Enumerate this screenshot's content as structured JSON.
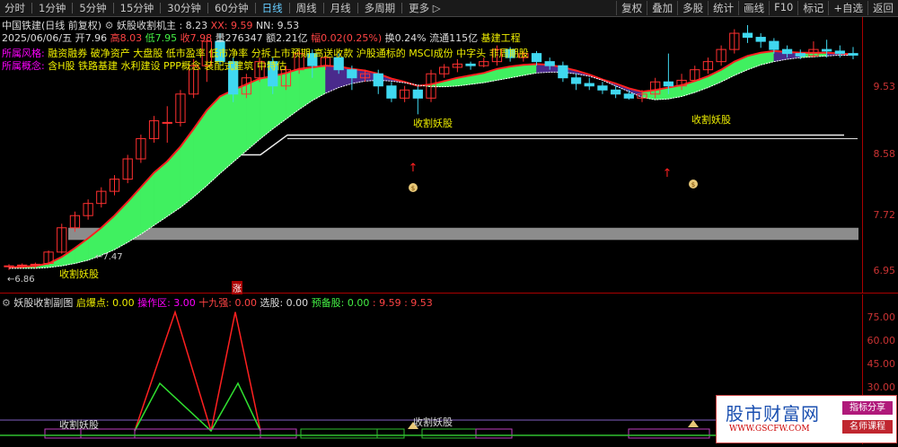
{
  "toolbar": {
    "items": [
      "分时",
      "1分钟",
      "5分钟",
      "15分钟",
      "30分钟",
      "60分钟",
      "日线",
      "周线",
      "月线",
      "多周期",
      "更多 ▷"
    ],
    "active_index": 6,
    "right_items": [
      "复权",
      "叠加",
      "多股",
      "统计",
      "画线",
      "F10",
      "标记",
      "+自选",
      "返回"
    ]
  },
  "header": {
    "stock": "中国铁建(日线 前复权)",
    "indicator": "妖股收割机主",
    "v1_label": ": 8.23",
    "xx_label": "XX: 9.59",
    "nn_label": "NN: 9.53",
    "bar_date": "2025/06/06/五",
    "open": "开7.96",
    "high": "高8.03",
    "low": "低7.95",
    "close": "收7.98",
    "volume": "量276347",
    "amount": "额2.21亿",
    "change": "幅0.02(0.25%)",
    "turnover": "换0.24%",
    "float": "流通115亿",
    "sector": "基建工程"
  },
  "style_line": {
    "label": "所属风格:",
    "text": "融资融券 破净资产 大盘股 低市盈率 低市净率 分拆上市预期 高送收款 沪股通标的 MSCI成份 中字头 非周期股"
  },
  "concept_line": {
    "label": "所属概念:",
    "text": "含H股 铁路基建 水利建设 PPP概念 装配式建筑 中特估"
  },
  "main_labels": {
    "harvest": "收割妖股",
    "low_price": "6.86",
    "mid_price": "7.47",
    "zhang": "涨"
  },
  "sub_header": {
    "name": "妖股收割副图",
    "f1": "启爆点: 0.00",
    "f2": "操作区: 3.00",
    "f3": "十九强: 0.00",
    "f4": "选股: 0.00",
    "f5": "预备股: 0.00",
    "f6": ": 9.59",
    "f7": ": 9.53"
  },
  "main_axis": [
    "9.53",
    "8.58",
    "7.72",
    "6.95"
  ],
  "sub_axis": [
    "75.00",
    "60.00",
    "45.00",
    "30.00"
  ],
  "watermark": {
    "title": "股市财富网",
    "url": "WWW.GSCFW.COM",
    "tag1": "指标分享",
    "tag2": "名师课程"
  },
  "chart_data": [
    {
      "type": "candlestick",
      "ylim": [
        6.6,
        10.0
      ],
      "candles": [
        [
          6.92,
          6.93,
          6.88,
          6.95
        ],
        [
          6.93,
          6.94,
          6.9,
          6.96
        ],
        [
          6.94,
          6.95,
          6.9,
          6.97
        ],
        [
          6.96,
          7.1,
          6.94,
          7.12
        ],
        [
          7.1,
          7.4,
          7.08,
          7.45
        ],
        [
          7.4,
          7.55,
          7.35,
          7.6
        ],
        [
          7.55,
          7.7,
          7.5,
          7.75
        ],
        [
          7.7,
          7.85,
          7.65,
          7.9
        ],
        [
          7.85,
          8.0,
          7.8,
          8.05
        ],
        [
          8.0,
          8.25,
          7.95,
          8.3
        ],
        [
          8.25,
          8.5,
          8.2,
          8.55
        ],
        [
          8.5,
          8.72,
          8.45,
          8.78
        ],
        [
          8.7,
          8.7,
          8.45,
          8.9
        ],
        [
          8.7,
          9.05,
          8.65,
          9.1
        ],
        [
          9.05,
          9.4,
          9.0,
          9.48
        ],
        [
          9.4,
          9.7,
          9.2,
          9.75
        ],
        [
          9.7,
          9.45,
          9.4,
          9.8
        ],
        [
          9.45,
          9.05,
          8.95,
          9.5
        ],
        [
          9.05,
          9.25,
          9.0,
          9.3
        ],
        [
          9.25,
          9.45,
          9.2,
          9.5
        ],
        [
          9.45,
          9.15,
          9.05,
          9.5
        ],
        [
          9.15,
          9.35,
          9.1,
          9.4
        ],
        [
          9.35,
          9.55,
          9.3,
          9.6
        ],
        [
          9.55,
          9.4,
          9.25,
          9.6
        ],
        [
          9.4,
          9.5,
          9.35,
          9.55
        ],
        [
          9.5,
          9.35,
          9.3,
          9.55
        ],
        [
          9.35,
          9.25,
          9.1,
          9.4
        ],
        [
          9.25,
          9.3,
          9.2,
          9.35
        ],
        [
          9.3,
          9.15,
          9.05,
          9.35
        ],
        [
          9.15,
          9.0,
          8.95,
          9.2
        ],
        [
          9.0,
          9.1,
          8.95,
          9.15
        ],
        [
          9.1,
          9.0,
          8.8,
          9.15
        ],
        [
          9.0,
          9.3,
          8.95,
          9.35
        ],
        [
          9.3,
          9.38,
          9.25,
          9.42
        ],
        [
          9.38,
          9.42,
          9.32,
          9.48
        ],
        [
          9.42,
          9.4,
          9.35,
          9.45
        ],
        [
          9.4,
          9.45,
          9.38,
          9.5
        ],
        [
          9.45,
          9.6,
          9.4,
          9.65
        ],
        [
          9.6,
          9.5,
          9.45,
          9.63
        ],
        [
          9.5,
          9.55,
          9.45,
          9.58
        ],
        [
          9.55,
          9.45,
          9.4,
          9.58
        ],
        [
          9.45,
          9.4,
          9.35,
          9.5
        ],
        [
          9.4,
          9.25,
          9.2,
          9.45
        ],
        [
          9.25,
          9.18,
          9.1,
          9.3
        ],
        [
          9.18,
          9.15,
          9.1,
          9.25
        ],
        [
          9.15,
          9.1,
          9.05,
          9.2
        ],
        [
          9.1,
          9.05,
          9.0,
          9.15
        ],
        [
          9.05,
          9.0,
          8.98,
          9.1
        ],
        [
          9.0,
          9.05,
          8.95,
          9.1
        ],
        [
          9.05,
          9.2,
          9.0,
          9.25
        ],
        [
          9.2,
          9.15,
          9.05,
          9.55
        ],
        [
          9.15,
          9.22,
          9.1,
          9.3
        ],
        [
          9.22,
          9.35,
          9.2,
          9.4
        ],
        [
          9.35,
          9.45,
          9.3,
          9.5
        ],
        [
          9.45,
          9.6,
          9.4,
          9.65
        ],
        [
          9.6,
          9.8,
          9.55,
          9.85
        ],
        [
          9.8,
          9.75,
          9.68,
          9.9
        ],
        [
          9.75,
          9.7,
          9.62,
          9.8
        ],
        [
          9.7,
          9.6,
          9.55,
          9.74
        ],
        [
          9.6,
          9.55,
          9.5,
          9.65
        ],
        [
          9.55,
          9.52,
          9.48,
          9.6
        ],
        [
          9.52,
          9.6,
          9.5,
          9.7
        ],
        [
          9.6,
          9.58,
          9.5,
          9.72
        ],
        [
          9.58,
          9.55,
          9.5,
          9.65
        ],
        [
          9.55,
          9.53,
          9.48,
          9.63
        ]
      ],
      "fast_line": [
        6.91,
        6.92,
        6.93,
        6.96,
        7.04,
        7.15,
        7.27,
        7.4,
        7.55,
        7.72,
        7.9,
        8.08,
        8.22,
        8.4,
        8.62,
        8.85,
        9.02,
        9.1,
        9.17,
        9.24,
        9.27,
        9.31,
        9.36,
        9.38,
        9.4,
        9.39,
        9.36,
        9.34,
        9.3,
        9.24,
        9.2,
        9.15,
        9.17,
        9.21,
        9.25,
        9.28,
        9.31,
        9.36,
        9.39,
        9.41,
        9.42,
        9.41,
        9.38,
        9.34,
        9.29,
        9.23,
        9.18,
        9.12,
        9.08,
        9.1,
        9.13,
        9.16,
        9.21,
        9.27,
        9.35,
        9.45,
        9.52,
        9.56,
        9.58,
        9.57,
        9.56,
        9.56,
        9.56,
        9.55,
        9.54
      ],
      "slow_line": [
        6.9,
        6.9,
        6.9,
        6.91,
        6.93,
        6.96,
        7.0,
        7.06,
        7.13,
        7.22,
        7.32,
        7.43,
        7.54,
        7.65,
        7.78,
        7.92,
        8.07,
        8.21,
        8.35,
        8.49,
        8.62,
        8.74,
        8.86,
        8.97,
        9.06,
        9.13,
        9.18,
        9.21,
        9.22,
        9.21,
        9.19,
        9.16,
        9.14,
        9.14,
        9.15,
        9.17,
        9.19,
        9.22,
        9.25,
        9.28,
        9.31,
        9.32,
        9.32,
        9.3,
        9.27,
        9.22,
        9.15,
        9.08,
        9.01,
        8.98,
        8.99,
        9.02,
        9.07,
        9.13,
        9.2,
        9.28,
        9.35,
        9.41,
        9.45,
        9.48,
        9.5,
        9.51,
        9.52,
        9.53,
        9.53
      ],
      "white_level_1": 8.5,
      "white_level_2": 8.3,
      "grey_band": [
        7.25,
        7.4
      ]
    },
    {
      "type": "line",
      "ylim": [
        0,
        85
      ],
      "ticks": [
        75,
        60,
        45,
        30
      ],
      "red_peaks": [
        [
          150,
          0
        ],
        [
          195,
          75
        ],
        [
          235,
          0
        ],
        [
          262,
          75
        ],
        [
          290,
          0
        ]
      ],
      "green_peaks": [
        [
          150,
          0
        ],
        [
          178,
          30
        ],
        [
          235,
          0
        ],
        [
          265,
          30
        ],
        [
          290,
          0
        ]
      ]
    }
  ]
}
